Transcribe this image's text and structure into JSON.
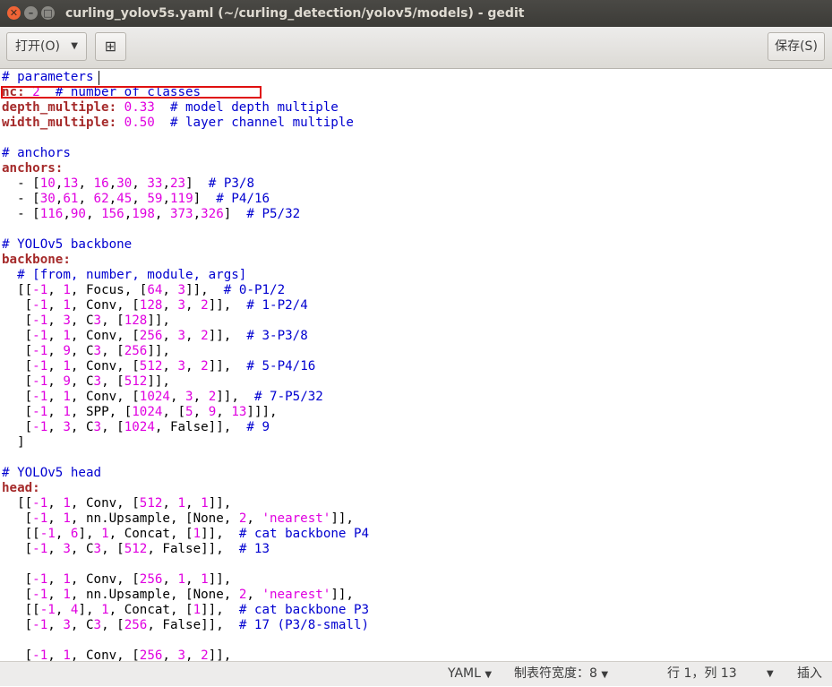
{
  "window": {
    "title": "curling_yolov5s.yaml (~/curling_detection/yolov5/models) - gedit",
    "close_glyph": "✕",
    "min_glyph": "–",
    "max_glyph": "□"
  },
  "toolbar": {
    "open_label": "打开(O)",
    "open_caret": "▼",
    "newtab_glyph": "⊞",
    "save_label": "保存(S)"
  },
  "editor": {
    "language": "yaml",
    "lines": [
      "# parameters",
      "nc: 2  # number of classes",
      "depth_multiple: 0.33  # model depth multiple",
      "width_multiple: 0.50  # layer channel multiple",
      "",
      "# anchors",
      "anchors:",
      "  - [10,13, 16,30, 33,23]  # P3/8",
      "  - [30,61, 62,45, 59,119]  # P4/16",
      "  - [116,90, 156,198, 373,326]  # P5/32",
      "",
      "# YOLOv5 backbone",
      "backbone:",
      "  # [from, number, module, args]",
      "  [[-1, 1, Focus, [64, 3]],  # 0-P1/2",
      "   [-1, 1, Conv, [128, 3, 2]],  # 1-P2/4",
      "   [-1, 3, C3, [128]],",
      "   [-1, 1, Conv, [256, 3, 2]],  # 3-P3/8",
      "   [-1, 9, C3, [256]],",
      "   [-1, 1, Conv, [512, 3, 2]],  # 5-P4/16",
      "   [-1, 9, C3, [512]],",
      "   [-1, 1, Conv, [1024, 3, 2]],  # 7-P5/32",
      "   [-1, 1, SPP, [1024, [5, 9, 13]]],",
      "   [-1, 3, C3, [1024, False]],  # 9",
      "  ]",
      "",
      "# YOLOv5 head",
      "head:",
      "  [[-1, 1, Conv, [512, 1, 1]],",
      "   [-1, 1, nn.Upsample, [None, 2, 'nearest']],",
      "   [[-1, 6], 1, Concat, [1]],  # cat backbone P4",
      "   [-1, 3, C3, [512, False]],  # 13",
      "",
      "   [-1, 1, Conv, [256, 1, 1]],",
      "   [-1, 1, nn.Upsample, [None, 2, 'nearest']],",
      "   [[-1, 4], 1, Concat, [1]],  # cat backbone P3",
      "   [-1, 3, C3, [256, False]],  # 17 (P3/8-small)",
      "",
      "   [-1, 1, Conv, [256, 3, 2]],"
    ]
  },
  "statusbar": {
    "language": "YAML",
    "tab_width": "制表符宽度：8",
    "position": "行 1，列 13",
    "mode": "插入",
    "caret": "▼"
  },
  "colors": {
    "comment": "#0000d0",
    "key": "#a52a2a",
    "number": "#e000e0",
    "highlight_box": "#e01010"
  }
}
